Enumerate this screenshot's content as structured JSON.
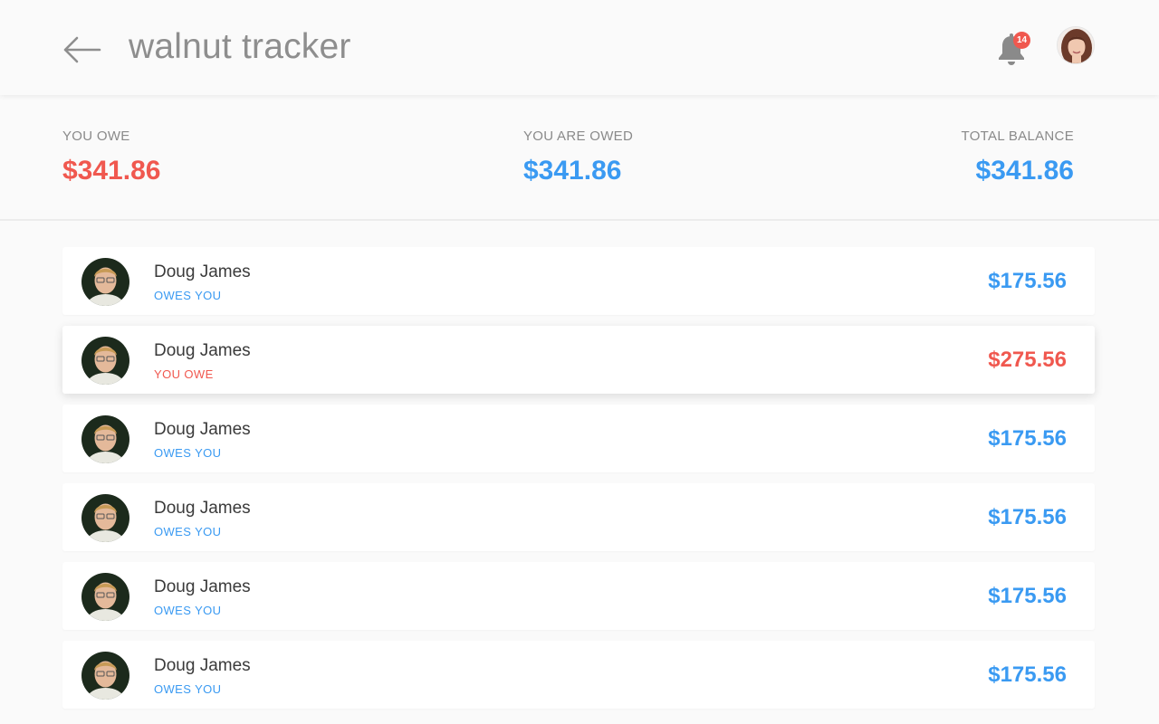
{
  "header": {
    "title": "walnut tracker",
    "notification_count": "14"
  },
  "summary": {
    "you_owe": {
      "label": "YOU OWE",
      "value": "$341.86"
    },
    "you_are_owed": {
      "label": "YOU ARE OWED",
      "value": "$341.86"
    },
    "total_balance": {
      "label": "TOTAL BALANCE",
      "value": "$341.86"
    }
  },
  "rows": [
    {
      "name": "Doug James",
      "status": "OWES YOU",
      "amount": "$175.56"
    },
    {
      "name": "Doug James",
      "status": "YOU OWE",
      "amount": "$275.56"
    },
    {
      "name": "Doug James",
      "status": "OWES YOU",
      "amount": "$175.56"
    },
    {
      "name": "Doug James",
      "status": "OWES YOU",
      "amount": "$175.56"
    },
    {
      "name": "Doug James",
      "status": "OWES YOU",
      "amount": "$175.56"
    },
    {
      "name": "Doug James",
      "status": "OWES YOU",
      "amount": "$175.56"
    }
  ],
  "colors": {
    "owe": "#f0584f",
    "owed": "#3a9af2",
    "badge": "#f0584f"
  },
  "icons": {
    "back": "arrow-left-icon",
    "notifications": "bell-icon"
  }
}
